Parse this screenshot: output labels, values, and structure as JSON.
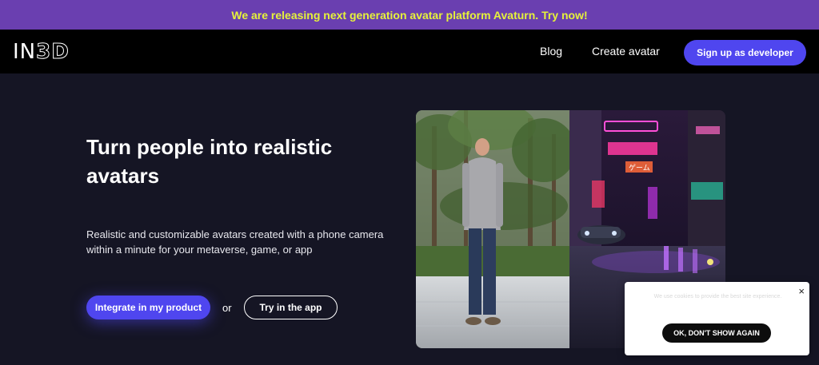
{
  "announcement": {
    "text": "We are releasing next generation avatar platform Avaturn. Try now!"
  },
  "nav": {
    "logo_text_thin": "IN",
    "logo_text_bold": "3D",
    "links": [
      {
        "label": "Blog"
      },
      {
        "label": "Create avatar"
      }
    ],
    "cta_label": "Sign up as developer"
  },
  "hero": {
    "title": "Turn people into realistic avatars",
    "description": "Realistic and customizable avatars created with a phone camera within a minute for your metaverse, game, or app",
    "primary_label": "Integrate in my product",
    "or_text": "or",
    "secondary_label": "Try in the app"
  },
  "neon_signs": [
    "ゲーム"
  ],
  "cookie": {
    "text": "We use cookies to provide the best site experience.",
    "button_label": "OK, DON'T SHOW AGAIN",
    "close_glyph": "×"
  },
  "colors": {
    "announcement_bg": "#6a3fb0",
    "announcement_text": "#e6f23a",
    "accent": "#4f46ef",
    "page_bg": "#151524"
  }
}
